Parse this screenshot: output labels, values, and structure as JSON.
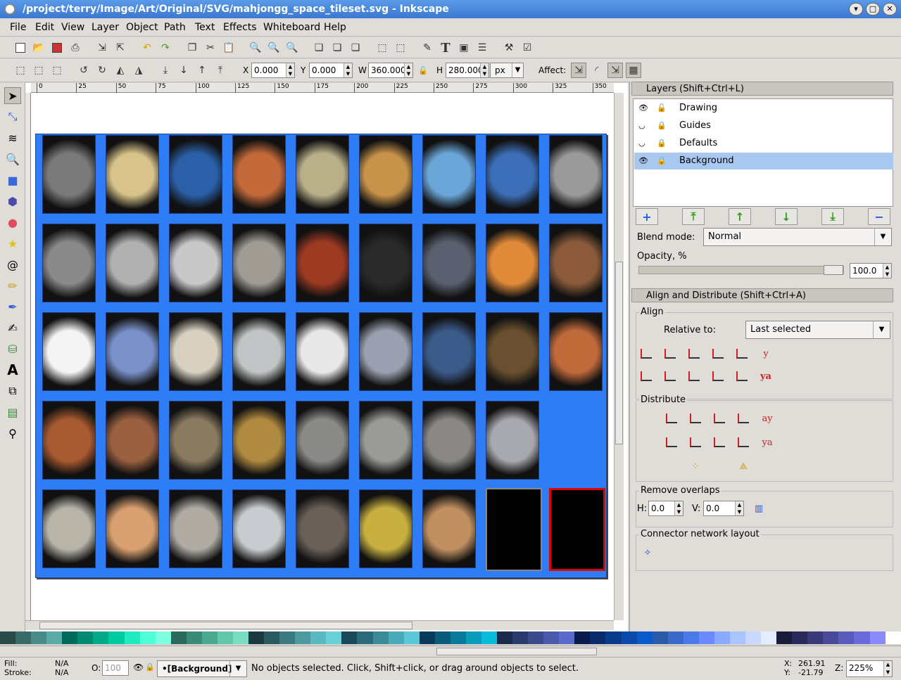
{
  "window": {
    "title": "/project/terry/Image/Art/Original/SVG/mahjongg_space_tileset.svg - Inkscape"
  },
  "menu": [
    "File",
    "Edit",
    "View",
    "Layer",
    "Object",
    "Path",
    "Text",
    "Effects",
    "Whiteboard",
    "Help"
  ],
  "toolbar2": {
    "x_label": "X",
    "x_value": "0.000",
    "y_label": "Y",
    "y_value": "0.000",
    "w_label": "W",
    "w_value": "360.000",
    "h_label": "H",
    "h_value": "280.000",
    "unit": "px",
    "affect_label": "Affect:"
  },
  "ruler_ticks": [
    "0",
    "25",
    "50",
    "75",
    "100",
    "125",
    "150",
    "175",
    "200",
    "225",
    "250",
    "275",
    "300",
    "325",
    "350"
  ],
  "layers_panel": {
    "title": "Layers (Shift+Ctrl+L)",
    "layers": [
      {
        "name": "Drawing",
        "selected": false
      },
      {
        "name": "Guides",
        "selected": false
      },
      {
        "name": "Defaults",
        "selected": false
      },
      {
        "name": "Background",
        "selected": true
      }
    ],
    "blend_label": "Blend mode:",
    "blend_value": "Normal",
    "opacity_label": "Opacity, %",
    "opacity_value": "100.0"
  },
  "align_panel": {
    "title": "Align and Distribute (Shift+Ctrl+A)",
    "align_label": "Align",
    "relative_label": "Relative to:",
    "relative_value": "Last selected",
    "distribute_label": "Distribute",
    "remove_overlaps_label": "Remove overlaps",
    "h_label": "H:",
    "h_value": "0.0",
    "v_label": "V:",
    "v_value": "0.0",
    "connector_label": "Connector network layout"
  },
  "status": {
    "fill_label": "Fill:",
    "fill_value": "N/A",
    "stroke_label": "Stroke:",
    "stroke_value": "N/A",
    "opacity_label": "O:",
    "opacity_value": "100",
    "layer_value": "•[Background]",
    "message": "No objects selected. Click, Shift+click, or drag around objects to select.",
    "x_label": "X:",
    "x_value": "261.91",
    "y_label": "Y:",
    "y_value": "-21.79",
    "z_label": "Z:",
    "zoom_value": "225%"
  },
  "tiles": [
    [
      "#7a7a7a",
      "#d8c48a",
      "#2b5fa8",
      "#c46a3a",
      "#b9b08a",
      "#c8934a",
      "#6aa6d8",
      "#3d6fb8",
      "#9a9a9a"
    ],
    [
      "#8a8a8a",
      "#b0b0b0",
      "#c8c8c8",
      "#a09c94",
      "#9c3a22",
      "#2a2a2a",
      "#5a6070",
      "#e08a3a",
      "#8a5a3a"
    ],
    [
      "#f4f4f4",
      "#7a90c8",
      "#d8d0c0",
      "#c0c4c4",
      "#e8e8e8",
      "#9aa0b0",
      "#3a5a8a",
      "#6a5030",
      "#c06a3a"
    ],
    [
      "#a85a30",
      "#9a6040",
      "#8a7a60",
      "#b08a40",
      "#8a8a88",
      "#9a9a96",
      "#8a8884",
      "#a8a8b0",
      ""
    ],
    [
      "#b8b4a8",
      "#d8a070",
      "#b0aca4",
      "#c8ccd0",
      "#6a6058",
      "#c8b040",
      "#c09060",
      "",
      ""
    ]
  ],
  "palette": [
    "#2a4a48",
    "#3a6a68",
    "#4a8a88",
    "#5aaaa8",
    "#006a5a",
    "#008a70",
    "#00aa88",
    "#00caa0",
    "#20eac0",
    "#50ffd8",
    "#80ffe0",
    "#2a6a5a",
    "#3a8a78",
    "#4aaa90",
    "#60c8a8",
    "#7adcc0",
    "#1a3a40",
    "#2a5a60",
    "#3a7a80",
    "#4a9aa0",
    "#5ab8c0",
    "#6ad0d8",
    "#1a4a5a",
    "#2a6a7a",
    "#3a8a9a",
    "#4aaaba",
    "#5ac8d8",
    "#0a3a5a",
    "#0a5a7a",
    "#0a7a9a",
    "#0a9aba",
    "#0abada",
    "#1a2a4a",
    "#2a3a6a",
    "#3a4a8a",
    "#4a5aaa",
    "#5a6aca",
    "#0a1a4a",
    "#0a2a6a",
    "#0a3a8a",
    "#0a4aaa",
    "#0a5aca",
    "#2a5aa8",
    "#3a6ac8",
    "#4a7ae8",
    "#6a8aff",
    "#8aaaff",
    "#aac4ff",
    "#c8d8ff",
    "#e4ecff",
    "#1a1a3a",
    "#2a2a5a",
    "#3a3a7a",
    "#4a4a9a",
    "#5a5aba",
    "#6a6ada",
    "#8a8aff",
    "#ffffff"
  ]
}
